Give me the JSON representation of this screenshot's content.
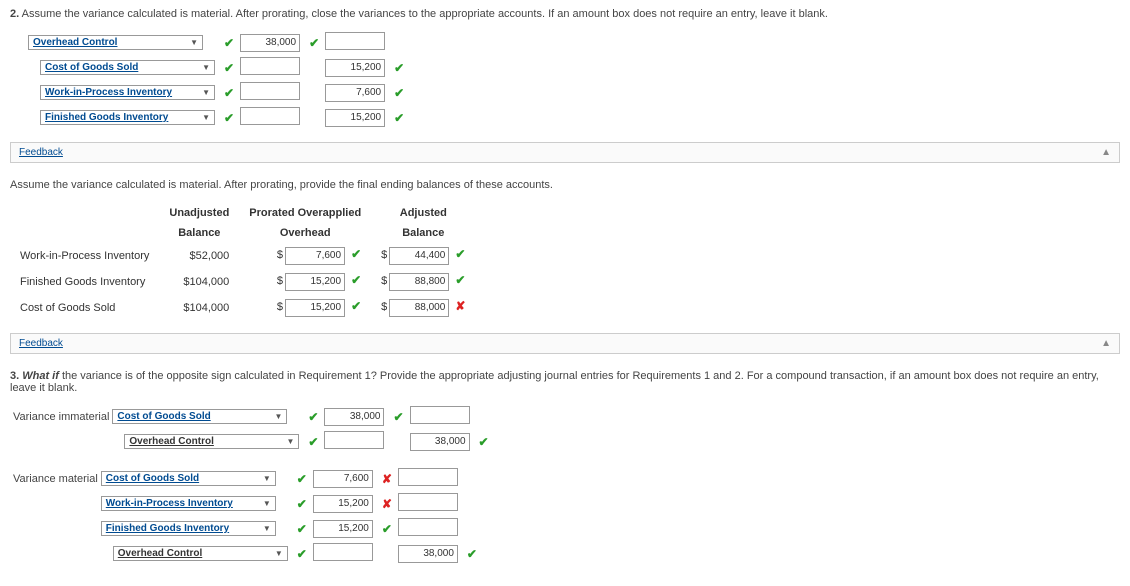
{
  "q2": {
    "prompt_num": "2.",
    "prompt_text": " Assume the variance calculated is material. After prorating, close the variances to the appropriate accounts. If an amount box does not require an entry, leave it blank.",
    "rows": [
      {
        "acct": "Overhead Control",
        "indent": 0,
        "debit": "38,000",
        "credit": "",
        "debit_mark": "check",
        "credit_mark": ""
      },
      {
        "acct": "Cost of Goods Sold",
        "indent": 1,
        "debit": "",
        "credit": "15,200",
        "debit_mark": "",
        "credit_mark": "check"
      },
      {
        "acct": "Work-in-Process Inventory",
        "indent": 1,
        "debit": "",
        "credit": "7,600",
        "debit_mark": "",
        "credit_mark": "check"
      },
      {
        "acct": "Finished Goods Inventory",
        "indent": 1,
        "debit": "",
        "credit": "15,200",
        "debit_mark": "",
        "credit_mark": "check"
      }
    ]
  },
  "feedback_label": "Feedback",
  "balances": {
    "intro": "Assume the variance calculated is material. After prorating, provide the final ending balances of these accounts.",
    "col1a": "Unadjusted",
    "col1b": "Balance",
    "col2a": "Prorated Overapplied",
    "col2b": "Overhead",
    "col3a": "Adjusted",
    "col3b": "Balance",
    "rows": [
      {
        "label": "Work-in-Process Inventory",
        "unadj": "$52,000",
        "prorated": "7,600",
        "prorated_mark": "check",
        "adj": "44,400",
        "adj_mark": "check"
      },
      {
        "label": "Finished Goods Inventory",
        "unadj": "$104,000",
        "prorated": "15,200",
        "prorated_mark": "check",
        "adj": "88,800",
        "adj_mark": "check"
      },
      {
        "label": "Cost of Goods Sold",
        "unadj": "$104,000",
        "prorated": "15,200",
        "prorated_mark": "check",
        "adj": "88,000",
        "adj_mark": "cross"
      }
    ]
  },
  "q3": {
    "prompt_num": "3.",
    "prompt_what": " What if",
    "prompt_rest": " the variance is of the opposite sign calculated in Requirement 1? Provide the appropriate adjusting journal entries for Requirements 1 and 2. For a compound transaction, if an amount box does not require an entry, leave it blank.",
    "imm_label": "Variance immaterial",
    "imm_rows": [
      {
        "acct": "Cost of Goods Sold",
        "indent": 0,
        "debit": "38,000",
        "credit": "",
        "debit_mark": "check",
        "credit_mark": ""
      },
      {
        "acct": "Overhead Control",
        "indent": 1,
        "debit": "",
        "credit": "38,000",
        "debit_mark": "",
        "credit_mark": "check",
        "credit_dark": true
      }
    ],
    "mat_label": "Variance material",
    "mat_rows": [
      {
        "acct": "Cost of Goods Sold",
        "indent": 0,
        "debit": "7,600",
        "credit": "",
        "debit_mark": "cross",
        "credit_mark": ""
      },
      {
        "acct": "Work-in-Process Inventory",
        "indent": 0,
        "debit": "15,200",
        "credit": "",
        "debit_mark": "cross",
        "credit_mark": ""
      },
      {
        "acct": "Finished Goods Inventory",
        "indent": 0,
        "debit": "15,200",
        "credit": "",
        "debit_mark": "check",
        "credit_mark": ""
      },
      {
        "acct": "Overhead Control",
        "indent": 1,
        "debit": "",
        "credit": "38,000",
        "debit_mark": "",
        "credit_mark": "check",
        "credit_dark": true
      }
    ]
  }
}
